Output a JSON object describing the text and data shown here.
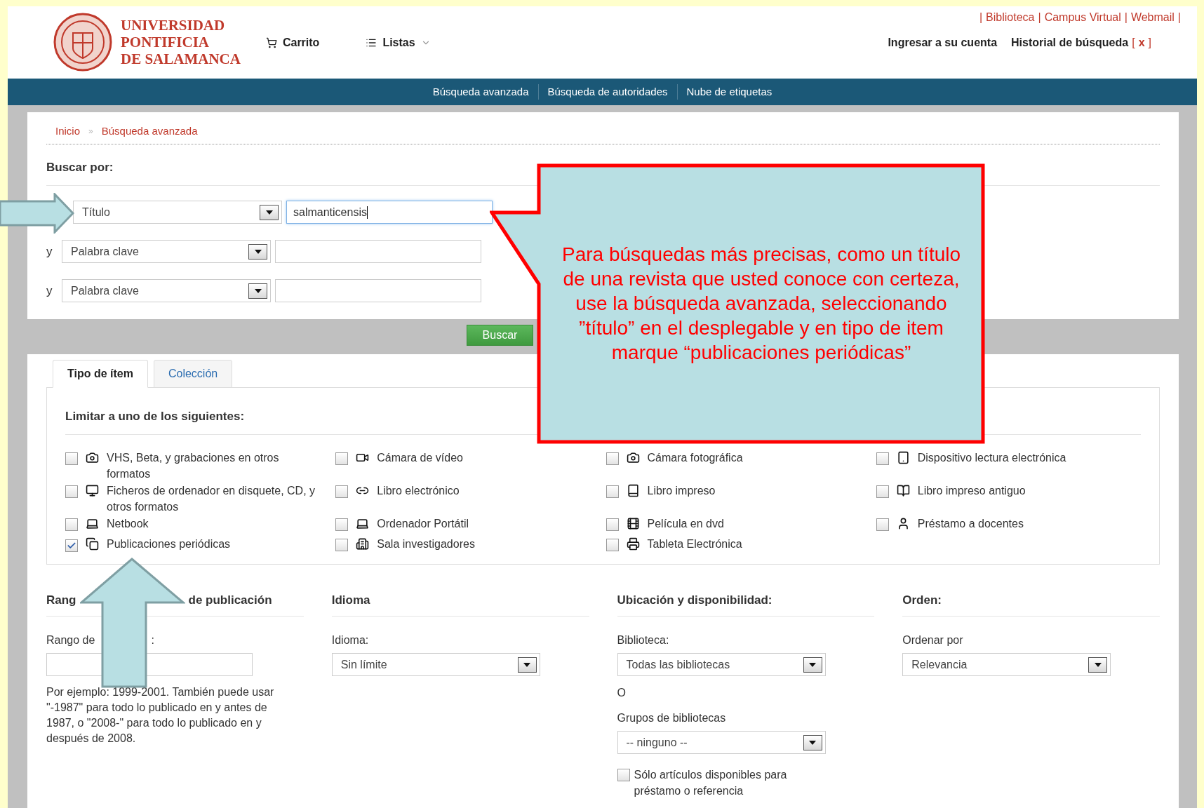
{
  "header": {
    "logo_lines": [
      "UNIVERSIDAD",
      "PONTIFICIA",
      "DE SALAMANCA"
    ],
    "cart": "Carrito",
    "lists": "Listas",
    "separator": "|",
    "top_links": [
      "Biblioteca",
      "Campus Virtual",
      "Webmail"
    ],
    "login": "Ingresar a su cuenta",
    "history": "Historial de búsqueda",
    "clear_open": "[",
    "clear": "x",
    "clear_close": "]"
  },
  "nav": [
    "Búsqueda avanzada",
    "Búsqueda de autoridades",
    "Nube de etiquetas"
  ],
  "breadcrumb": {
    "items": [
      "Inicio",
      "Búsqueda avanzada"
    ],
    "separator": "»"
  },
  "search": {
    "heading": "Buscar por:",
    "rows": [
      {
        "conjunction": "",
        "field": "Título",
        "value": "salmanticensis",
        "focused": true
      },
      {
        "conjunction": "y",
        "field": "Palabra clave",
        "value": "",
        "focused": false
      },
      {
        "conjunction": "y",
        "field": "Palabra clave",
        "value": "",
        "focused": false
      }
    ],
    "button": "Buscar"
  },
  "tabs": [
    {
      "label": "Tipo de ítem",
      "selected": true
    },
    {
      "label": "Colección",
      "selected": false
    }
  ],
  "limit_heading": "Limitar a uno de los siguientes:",
  "item_types": [
    {
      "label": "VHS, Beta, y grabaciones en otros formatos",
      "checked": false
    },
    {
      "label": "Cámara de vídeo",
      "checked": false
    },
    {
      "label": "Cámara fotográfica",
      "checked": false
    },
    {
      "label": "Dispositivo lectura electrónica",
      "checked": false
    },
    {
      "label": "Ficheros de ordenador en disquete, CD, y otros formatos",
      "checked": false
    },
    {
      "label": "Libro electrónico",
      "checked": false
    },
    {
      "label": "Libro impreso",
      "checked": false
    },
    {
      "label": "Libro impreso antiguo",
      "checked": false
    },
    {
      "label": "Netbook",
      "checked": false
    },
    {
      "label": "Ordenador Portátil",
      "checked": false
    },
    {
      "label": "Película en dvd",
      "checked": false
    },
    {
      "label": "Préstamo a docentes",
      "checked": false
    },
    {
      "label": "Publicaciones periódicas",
      "checked": true
    },
    {
      "label": "Sala investigadores",
      "checked": false
    },
    {
      "label": "Tableta Electrónica",
      "checked": false
    }
  ],
  "date_range": {
    "heading_parts": [
      "Rang",
      "de publicación"
    ],
    "label_parts": [
      "Rango de",
      ":"
    ],
    "help": "Por ejemplo: 1999-2001. También puede usar \"-1987\" para todo lo publicado en y antes de 1987, o \"2008-\" para todo lo publicado en y después de 2008."
  },
  "language": {
    "heading": "Idioma",
    "label": "Idioma:",
    "value": "Sin límite"
  },
  "location": {
    "heading": "Ubicación y disponibilidad:",
    "library_label": "Biblioteca:",
    "library_value": "Todas las bibliotecas",
    "or": "O",
    "groups_label": "Grupos de bibliotecas",
    "groups_value": "-- ninguno --",
    "available_label": "Sólo artículos disponibles para préstamo o referencia",
    "available_checked": false
  },
  "sort": {
    "heading": "Orden:",
    "label": "Ordenar por",
    "value": "Relevancia"
  },
  "callout": {
    "text": "Para búsquedas más precisas, como un título de una revista que usted conoce con certeza, use la búsqueda avanzada, seleccionando ”título” en el desplegable y en tipo de item marque “publicaciones periódicas”"
  }
}
